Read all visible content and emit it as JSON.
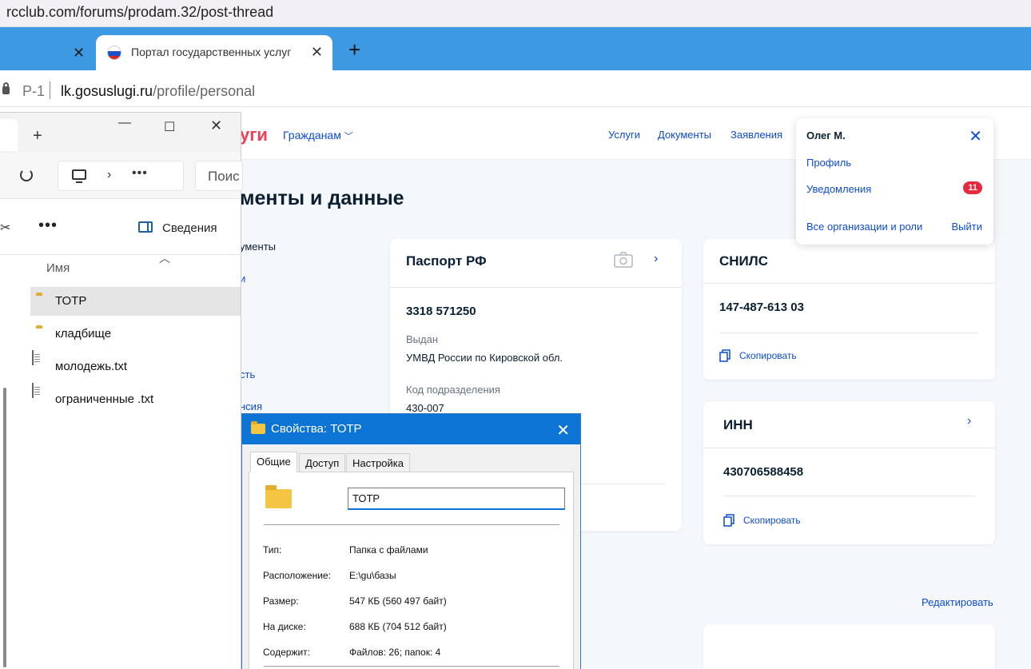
{
  "browser": {
    "top_url": "rcclub.com/forums/prodam.32/post-thread",
    "tab_title": "Портал государственных услуг",
    "address_prefix": "Р-1",
    "address_domain": "lk.gosuslugi.ru",
    "address_path": "/profile/personal"
  },
  "site": {
    "logo_fragment": "уги",
    "nav_citizens": "Гражданам",
    "nav": [
      "Услуги",
      "Документы",
      "Заявления"
    ],
    "page_title_fragment": "менты и данные",
    "side_fragments": [
      "ументы",
      "и",
      "сть",
      "нсия"
    ],
    "edit_link": "Редактировать"
  },
  "passport": {
    "title": "Паспорт РФ",
    "number": "3318 571250",
    "issued_label": "Выдан",
    "issued_value": "УМВД России по Кировской обл.",
    "code_label": "Код подразделения",
    "code_value": "430-007"
  },
  "snils": {
    "title": "СНИЛС",
    "number": "147-487-613 03",
    "copy": "Скопировать"
  },
  "inn": {
    "title": "ИНН",
    "number": "430706588458",
    "copy": "Скопировать"
  },
  "profile_menu": {
    "name": "Олег М.",
    "profile": "Профиль",
    "notifications": "Уведомления",
    "notifications_count": "11",
    "orgs": "Все организации и роли",
    "logout": "Выйти"
  },
  "explorer": {
    "search_placeholder": "Поис",
    "details": "Сведения",
    "column_name": "Имя",
    "items": [
      {
        "name": "ТОТР",
        "type": "folder"
      },
      {
        "name": "кладбище",
        "type": "folder"
      },
      {
        "name": "молодежь.txt",
        "type": "file"
      },
      {
        "name": "ограниченные .txt",
        "type": "file"
      }
    ]
  },
  "properties": {
    "title": "Свойства: ТОТР",
    "tabs": [
      "Общие",
      "Доступ",
      "Настройка"
    ],
    "name_value": "ТОТР",
    "rows": [
      {
        "key": "Тип:",
        "value": "Папка с файлами"
      },
      {
        "key": "Расположение:",
        "value": "E:\\gu\\базы"
      },
      {
        "key": "Размер:",
        "value": "547 КБ (560 497 байт)"
      },
      {
        "key": "На диске:",
        "value": "688 КБ (704 512 байт)"
      },
      {
        "key": "Содержит:",
        "value": "Файлов: 26; папок: 4"
      }
    ]
  },
  "colors": {
    "tab_bar": "#3d9ae2",
    "gosuslugi_link": "#0d4cd3",
    "badge": "#e8283c",
    "dialog_title": "#0b74d4"
  }
}
